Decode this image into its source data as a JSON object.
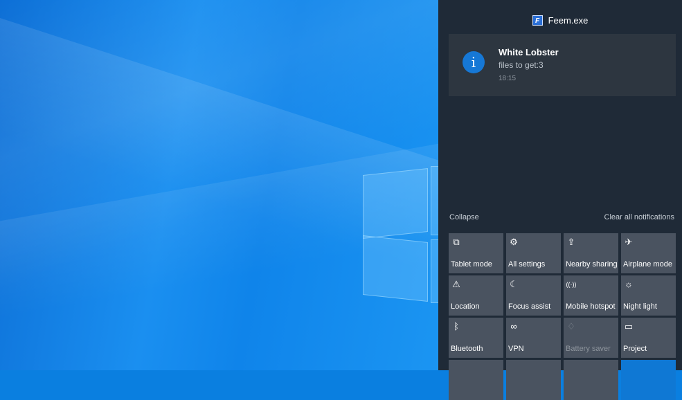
{
  "notification_app": {
    "name": "Feem.exe",
    "icon": "feem-app-icon"
  },
  "toast": {
    "icon": "info-icon",
    "icon_glyph": "i",
    "title": "White Lobster",
    "body": "files to get:3",
    "time": "18:15"
  },
  "controls": {
    "collapse": "Collapse",
    "clear_all": "Clear all notifications"
  },
  "quick_actions": [
    {
      "label": "Tablet mode",
      "icon": "tablet-mode-icon",
      "glyph": "⧉"
    },
    {
      "label": "All settings",
      "icon": "gear-icon",
      "glyph": "⚙"
    },
    {
      "label": "Nearby sharing",
      "icon": "share-icon",
      "glyph": "⇪"
    },
    {
      "label": "Airplane mode",
      "icon": "airplane-icon",
      "glyph": "✈"
    },
    {
      "label": "Location",
      "icon": "location-icon",
      "glyph": "⚠"
    },
    {
      "label": "Focus assist",
      "icon": "moon-icon",
      "glyph": "☾"
    },
    {
      "label": "Mobile hotspot",
      "icon": "hotspot-icon",
      "glyph": "((·))"
    },
    {
      "label": "Night light",
      "icon": "brightness-icon",
      "glyph": "☼"
    },
    {
      "label": "Bluetooth",
      "icon": "bluetooth-icon",
      "glyph": "ᛒ"
    },
    {
      "label": "VPN",
      "icon": "vpn-icon",
      "glyph": "∞"
    },
    {
      "label": "Battery saver",
      "icon": "leaf-icon",
      "glyph": "♢"
    },
    {
      "label": "Project",
      "icon": "project-icon",
      "glyph": "▭"
    },
    {
      "label": "",
      "icon": "network-icon",
      "glyph": ""
    },
    {
      "label": "",
      "icon": "connect-icon",
      "glyph": ""
    },
    {
      "label": "",
      "icon": "moon-icon",
      "glyph": ""
    },
    {
      "label": "",
      "icon": "wifi-icon",
      "glyph": ""
    }
  ],
  "colors": {
    "panel_bg": "#1f2a37",
    "tile_bg": "#4a5360",
    "accent": "#0f78d4"
  }
}
